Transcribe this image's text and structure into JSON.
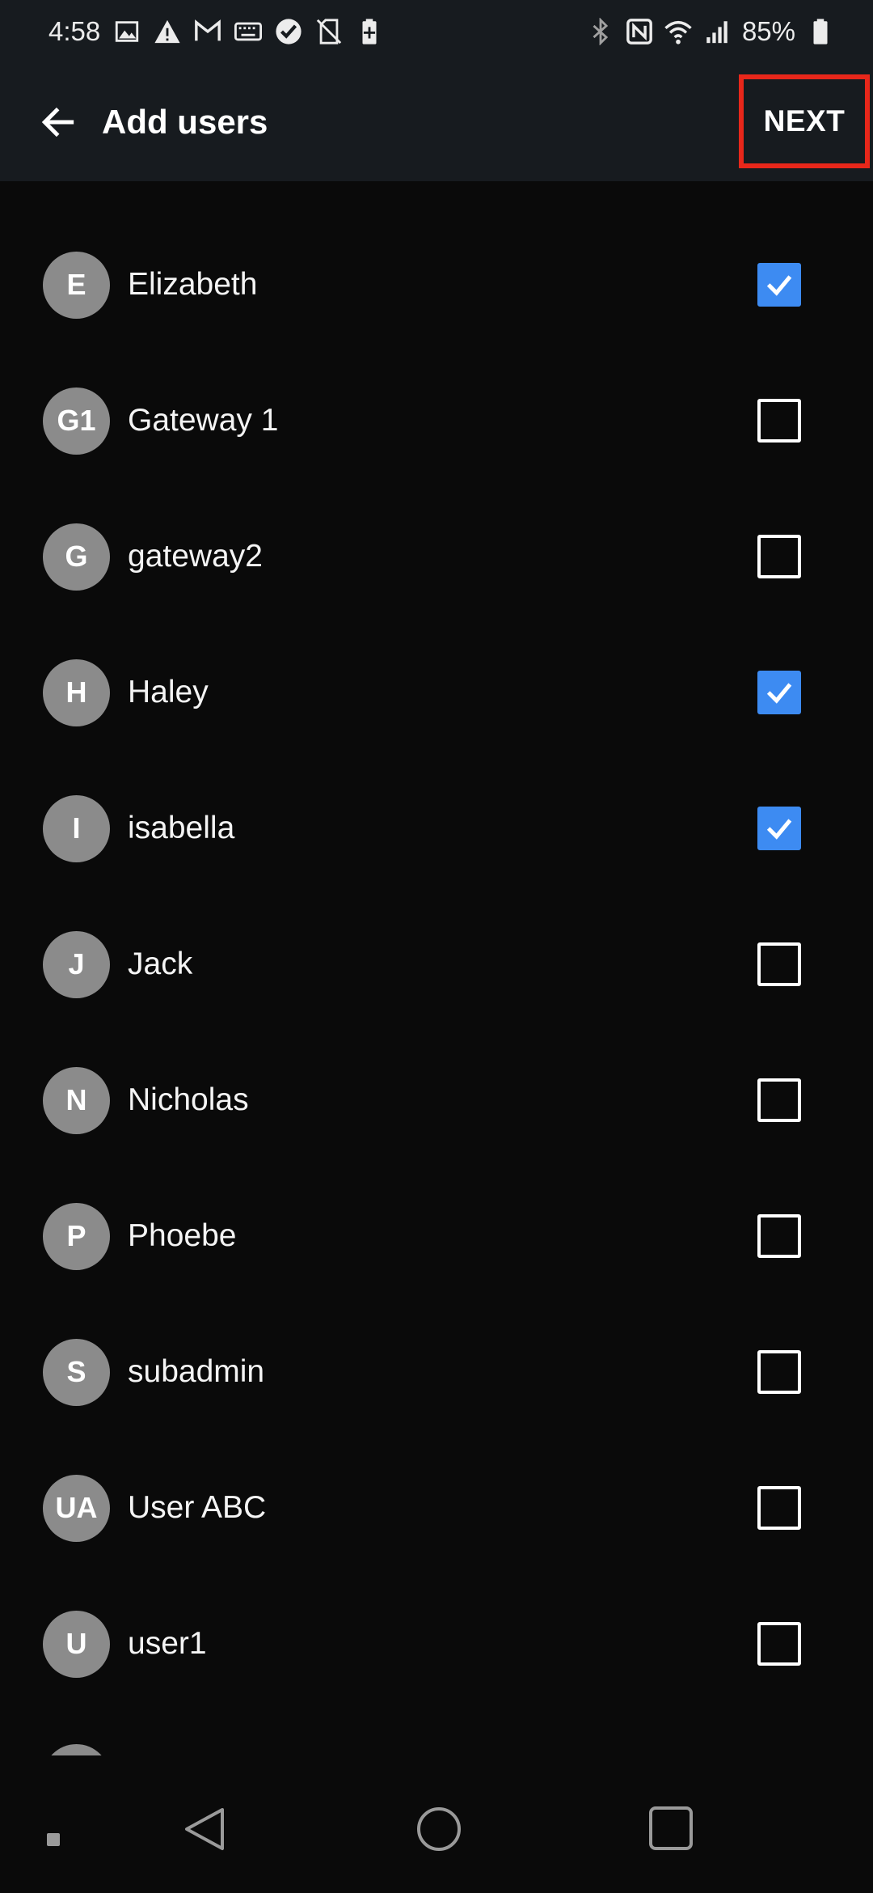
{
  "status_bar": {
    "time": "4:58",
    "battery_percent": "85%",
    "left_icons": [
      "image-icon",
      "warning-icon",
      "gmail-icon",
      "keyboard-icon",
      "check-badge-icon",
      "no-sim-icon",
      "battery-saver-icon"
    ],
    "right_icons": [
      "bluetooth-icon",
      "nfc-icon",
      "wifi-icon",
      "signal-icon",
      "battery-icon"
    ]
  },
  "app_bar": {
    "title": "Add users",
    "next_label": "NEXT",
    "highlight_color": "#e8271a"
  },
  "users": [
    {
      "initials": "E",
      "name": "Elizabeth",
      "checked": true
    },
    {
      "initials": "G1",
      "name": "Gateway 1",
      "checked": false
    },
    {
      "initials": "G",
      "name": "gateway2",
      "checked": false
    },
    {
      "initials": "H",
      "name": "Haley",
      "checked": true
    },
    {
      "initials": "I",
      "name": "isabella",
      "checked": true
    },
    {
      "initials": "J",
      "name": "Jack",
      "checked": false
    },
    {
      "initials": "N",
      "name": "Nicholas",
      "checked": false
    },
    {
      "initials": "P",
      "name": "Phoebe",
      "checked": false
    },
    {
      "initials": "S",
      "name": "subadmin",
      "checked": false
    },
    {
      "initials": "UA",
      "name": "User ABC",
      "checked": false
    },
    {
      "initials": "U",
      "name": "user1",
      "checked": false
    }
  ],
  "colors": {
    "checked": "#3d8bf2",
    "avatar": "#8b8b8b",
    "bar_background": "#171b1f",
    "background": "#0a0a0a"
  },
  "nav_bar": {
    "icons": [
      "recents-dot-icon",
      "back-triangle-icon",
      "home-circle-icon",
      "overview-square-icon"
    ]
  }
}
